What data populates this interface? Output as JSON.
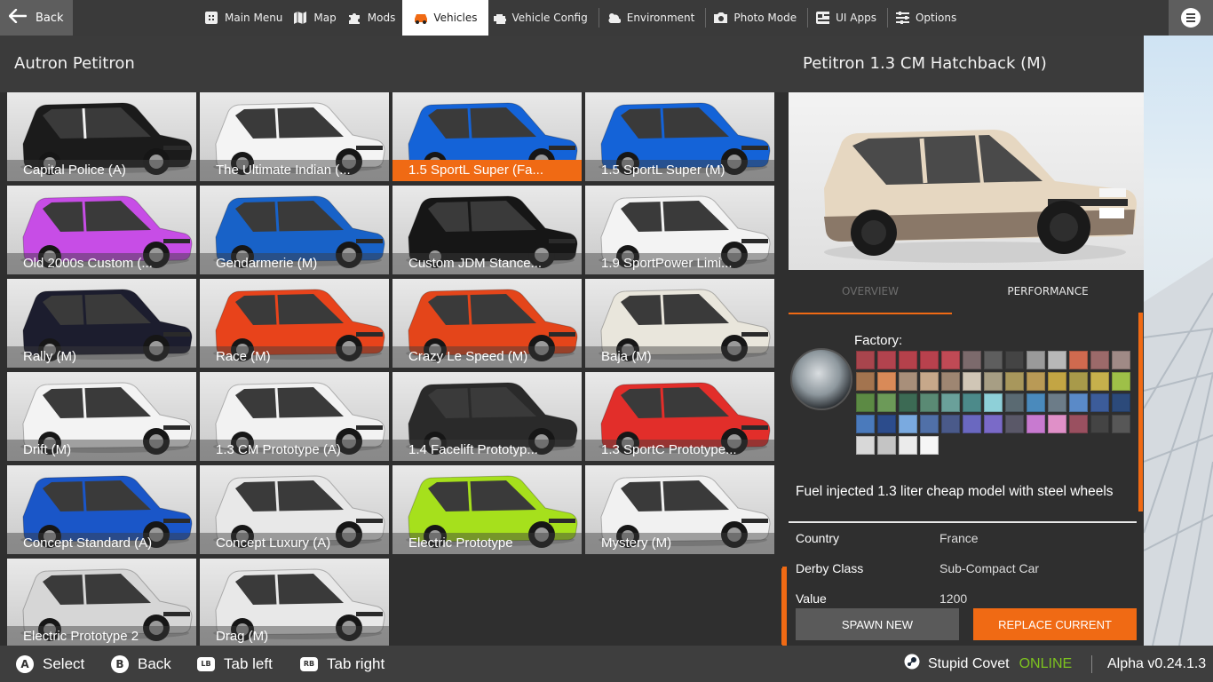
{
  "topbar": {
    "back_label": "Back",
    "tabs": [
      {
        "label": "Main Menu",
        "icon": "main-menu-icon"
      },
      {
        "label": "Map",
        "icon": "map-icon"
      },
      {
        "label": "Mods",
        "icon": "puzzle-icon"
      },
      {
        "label": "Vehicles",
        "icon": "car-icon",
        "active": true
      },
      {
        "label": "Vehicle Config",
        "icon": "engine-icon"
      },
      {
        "label": "Environment",
        "icon": "weather-icon"
      },
      {
        "label": "Photo Mode",
        "icon": "camera-icon"
      },
      {
        "label": "UI Apps",
        "icon": "ui-apps-icon"
      },
      {
        "label": "Options",
        "icon": "sliders-icon"
      }
    ]
  },
  "left": {
    "title": "Autron Petitron",
    "configs": [
      {
        "label": "Capital Police (A)",
        "color": "#1b1b1b",
        "roof": "#f2f2f2",
        "doors": "#f2f2f2"
      },
      {
        "label": "The Ultimate Indian (...",
        "color": "#f4f4f4",
        "roof": "#f4f4f4",
        "doors": "#f4f4f4"
      },
      {
        "label": "1.5 SportL Super (Fa...",
        "color": "#1463d8",
        "roof": "#1463d8",
        "doors": "#1463d8",
        "selected": true
      },
      {
        "label": "1.5 SportL Super (M)",
        "color": "#1463d8",
        "roof": "#1463d8",
        "doors": "#1463d8"
      },
      {
        "label": "Old 2000s Custom (...",
        "color": "#c74de6",
        "roof": "#c74de6",
        "doors": "#c74de6"
      },
      {
        "label": "Gendarmerie (M)",
        "color": "#1862c8",
        "roof": "#1862c8",
        "doors": "#1862c8"
      },
      {
        "label": "Custom JDM Stance...",
        "color": "#161616",
        "roof": "#161616",
        "doors": "#161616"
      },
      {
        "label": "1.9 SportPower Limi...",
        "color": "#f3f3f3",
        "roof": "#f3f3f3",
        "doors": "#f3f3f3"
      },
      {
        "label": "Rally (M)",
        "color": "#1c1d2e",
        "roof": "#1c1d2e",
        "doors": "#1c1d2e"
      },
      {
        "label": "Race (M)",
        "color": "#e8431b",
        "roof": "#e8431b",
        "doors": "#e8431b"
      },
      {
        "label": "Crazy Le Speed (M)",
        "color": "#e4451a",
        "roof": "#e4451a",
        "doors": "#e4451a"
      },
      {
        "label": "Baja (M)",
        "color": "#e9e6dc",
        "roof": "#e9e6dc",
        "doors": "#e9e6dc"
      },
      {
        "label": "Drift (M)",
        "color": "#f3f3f3",
        "roof": "#f3f3f3",
        "doors": "#f3f3f3"
      },
      {
        "label": "1.3 CM Prototype (A)",
        "color": "#f2f2f2",
        "roof": "#f2f2f2",
        "doors": "#f2f2f2"
      },
      {
        "label": "1.4 Facelift Prototyp...",
        "color": "#2a2a2a",
        "roof": "#2a2a2a",
        "doors": "#2a2a2a"
      },
      {
        "label": "1.3 SportC Prototype...",
        "color": "#e22e2a",
        "roof": "#e22e2a",
        "doors": "#e22e2a"
      },
      {
        "label": "Concept Standard (A)",
        "color": "#1a56c8",
        "roof": "#1a56c8",
        "doors": "#1a56c8"
      },
      {
        "label": "Concept Luxury (A)",
        "color": "#e8e8e8",
        "roof": "#e8e8e8",
        "doors": "#e8e8e8"
      },
      {
        "label": "Electric Prototype",
        "color": "#a6e01c",
        "roof": "#a6e01c",
        "doors": "#a6e01c"
      },
      {
        "label": "Mystery (M)",
        "color": "#f1f1f1",
        "roof": "#f1f1f1",
        "doors": "#f1f1f1"
      },
      {
        "label": "Electric Prototype 2",
        "color": "#d6d6d6",
        "roof": "#d6d6d6",
        "doors": "#d6d6d6"
      },
      {
        "label": "Drag (M)",
        "color": "#e8e8e8",
        "roof": "#e8e8e8",
        "doors": "#e8e8e8"
      }
    ]
  },
  "right": {
    "title": "Petitron 1.3 CM Hatchback (M)",
    "preview_color": "#e6d7c1",
    "tabs": {
      "overview": "OVERVIEW",
      "performance": "PERFORMANCE"
    },
    "paint_label": "Factory:",
    "swatches": [
      "#a8454d",
      "#b2434e",
      "#b5414b",
      "#b8414d",
      "#c04a55",
      "#7c6a6c",
      "#5e5e5e",
      "#444444",
      "#9a9a9a",
      "#b8b8b8",
      "#d06a4f",
      "#9c6a6a",
      "#a08a86",
      "#a3744f",
      "#d98a58",
      "#a88f7a",
      "#c7a88a",
      "#9e8672",
      "#d0c6b6",
      "#a79e84",
      "#a8975c",
      "#b99a56",
      "#c3a544",
      "#a89a4a",
      "#c6b04c",
      "#9ec048",
      "#5c8a44",
      "#6c9a58",
      "#3c6a54",
      "#5a8a74",
      "#6aa09a",
      "#4c8a8a",
      "#8ed0d8",
      "#5a6a72",
      "#4a8abc",
      "#6c7c88",
      "#5a8ac8",
      "#3c5c9a",
      "#2c4a7a",
      "#4a7abc",
      "#2c4c8c",
      "#7aaae0",
      "#5070a8",
      "#4a5a8a",
      "#6a68c0",
      "#7a6ac8",
      "#5a5868",
      "#c87ad0",
      "#e090c8",
      "#9a5060",
      "#444444",
      "#575757",
      "#d8d8d8",
      "#c4c4c4",
      "#ebebeb",
      "#f6f6f6"
    ],
    "description": "Fuel injected 1.3 liter cheap model with steel wheels",
    "info": [
      {
        "key": "Country",
        "value": "France"
      },
      {
        "key": "Derby Class",
        "value": "Sub-Compact Car"
      },
      {
        "key": "Value",
        "value": "1200"
      }
    ],
    "spawn_label": "SPAWN NEW",
    "replace_label": "REPLACE CURRENT"
  },
  "bottombar": {
    "hints": [
      {
        "key": "A",
        "label": "Select"
      },
      {
        "key": "B",
        "label": "Back"
      },
      {
        "key": "LB",
        "label": "Tab left"
      },
      {
        "key": "RB",
        "label": "Tab right"
      }
    ],
    "username": "Stupid Covet",
    "status": "ONLINE",
    "version": "Alpha v0.24.1.3"
  },
  "colors": {
    "accent": "#f06a14",
    "online": "#7dc31f"
  }
}
